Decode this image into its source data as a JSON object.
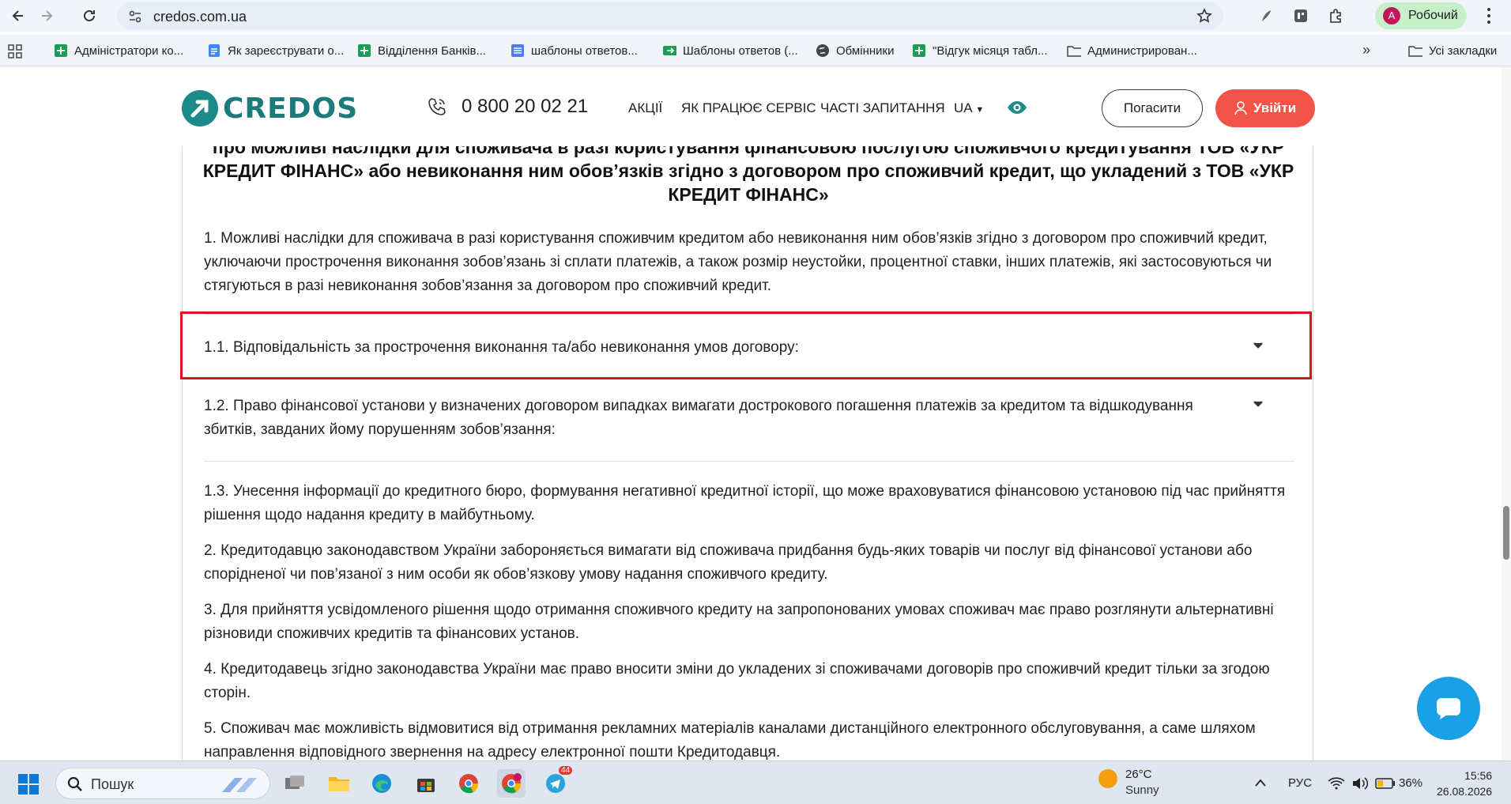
{
  "browser": {
    "url": "credos.com.ua",
    "profile_initial": "A",
    "profile_name": "Робочий",
    "bookmarks": [
      "Адміністратори ко...",
      "Як зареєструвати о...",
      "Відділення Банків...",
      "шаблоны ответов...",
      "Шаблоны ответов (...",
      "Обмінники",
      "\"Відгук місяця табл...",
      "Администрирован..."
    ],
    "all_bookmarks": "Усі закладки"
  },
  "site": {
    "logo_text": "CREDOS",
    "phone": "0 800 20 02 21",
    "nav": [
      "АКЦІЇ",
      "ЯК ПРАЦЮЄ СЕРВІС",
      "ЧАСТІ ЗАПИТАННЯ"
    ],
    "lang": "UA",
    "pay_button": "Погасити",
    "login_button": "Увійти",
    "accent_color": "#f3544a",
    "brand_color": "#1d7a7a"
  },
  "content": {
    "heading": "про можливі наслідки для споживача в разі користування фінансовою послугою споживчого кредитування ТОВ «УКР КРЕДИТ ФІНАНС» або невиконання ним обов’язків згідно з договором про споживчий кредит, що укладений з ТОВ «УКР КРЕДИТ ФІНАНС»",
    "intro": "1. Можливі наслідки для споживача в разі користування споживчим кредитом або невиконання ним обов’язків згідно з договором про споживчий кредит, уключаючи прострочення виконання зобов’язань зі сплати платежів, а також розмір неустойки, процентної ставки, інших платежів, які застосовуються чи стягуються в разі невиконання зобов’язання за договором про споживчий кредит.",
    "accordion_1": "1.1. Відповідальність за прострочення виконання та/або невиконання умов договору:",
    "accordion_2": "1.2. Право фінансової установи у визначених договором випадках вимагати дострокового погашення платежів за кредитом та відшкодування збитків, завданих йому порушенням зобов’язання:",
    "item_1_3": "1.3. Унесення інформації до кредитного бюро, формування негативної кредитної історії, що може враховуватися фінансовою установою під час прийняття рішення щодо надання кредиту в майбутньому.",
    "item_2": "2. Кредитодавцю законодавством України забороняється вимагати від споживача придбання будь-яких товарів чи послуг від фінансової установи або спорідненої чи пов’язаної з ним особи як обов’язкову умову надання споживчого кредиту.",
    "item_3": "3. Для прийняття усвідомленого рішення щодо отримання споживчого кредиту на запропонованих умовах споживач має право розглянути альтернативні різновиди споживчих кредитів та фінансових установ.",
    "item_4": "4. Кредитодавець згідно законодавства України має право вносити зміни до укладених зі споживачами договорів про споживчий кредит тільки за згодою сторін.",
    "item_5": "5. Споживач має можливість відмовитися від отримання рекламних матеріалів каналами дистанційного електронного обслуговування, а саме шляхом направлення відповідного звернення на адресу електронної пошти Кредитодавця."
  },
  "taskbar": {
    "search_placeholder": "Пошук",
    "telegram_badge": "44",
    "temperature": "26°C",
    "weather": "Sunny",
    "language": "РУС",
    "battery": "36%",
    "time": "15:56",
    "date": "26.08.2026"
  }
}
